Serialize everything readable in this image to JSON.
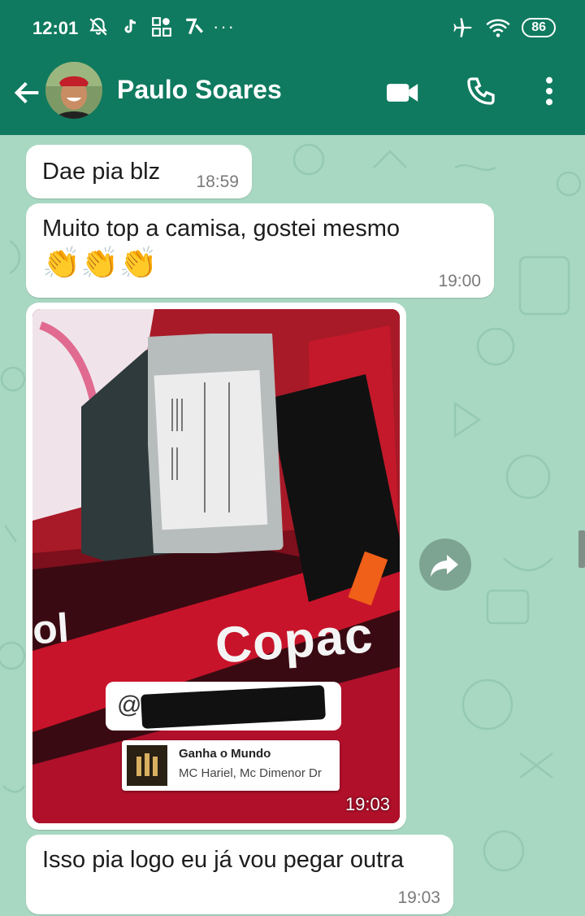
{
  "status_bar": {
    "time": "12:01",
    "left_icons": [
      "bell-off-icon",
      "tiktok-icon",
      "app-grid-icon",
      "speed-icon"
    ],
    "overflow": "···",
    "right_icons": [
      "airplane-icon",
      "wifi-icon"
    ],
    "battery": "86"
  },
  "header": {
    "contact_name": "Paulo Soares",
    "icons": [
      "back-arrow-icon",
      "video-call-icon",
      "phone-call-icon",
      "more-vertical-icon"
    ]
  },
  "messages": [
    {
      "text": "Dae pia blz",
      "time": "18:59"
    },
    {
      "text": "Muito top a camisa, gostei mesmo",
      "emoji": "👏👏👏",
      "time": "19:00"
    },
    {
      "type": "image",
      "caption_overlay": {
        "mention_prefix": "@",
        "music_title": "Ganha o Mundo",
        "music_artist": "MC Hariel, Mc Dimenor Dr"
      },
      "shirt_text": "Copac",
      "shirt_text_left": "ol",
      "time": "19:03"
    },
    {
      "text": "Isso pia logo eu já vou pegar outra",
      "time": "19:03"
    }
  ],
  "colors": {
    "header": "#0f7a5f",
    "wallpaper": "#a8d8c2",
    "bubble": "#ffffff",
    "shirt_red": "#8c1020"
  }
}
